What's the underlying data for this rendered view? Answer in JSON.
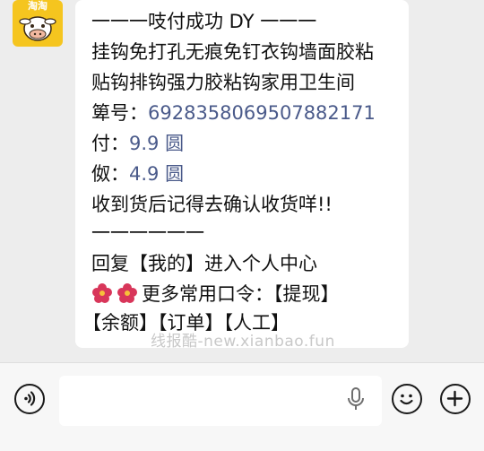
{
  "avatar": {
    "brand_text": "淘淘"
  },
  "message": {
    "line1": "一一一吱付成功 DY 一一一",
    "line2": "挂钩免打孔无痕免钉衣钩墙面胶粘",
    "line3": "贴钩排钩强力胶粘钩家用卫生间",
    "order_label": "箄号：",
    "order_number": "6928358069507882171",
    "paid_label": "付：",
    "paid_value": "9.9 圆",
    "refund_label": "伮：",
    "refund_value": "4.9 圆",
    "reminder": "收到货后记得去确认收货咩!!",
    "divider": "一一一一一一",
    "reply_hint": "回复【我的】进入个人中心",
    "more_commands": "更多常用口令：【提现】",
    "commands_line": "【余额】【订单】【人工】"
  },
  "watermark": "线报酷-new.xianbao.fun",
  "input_bar": {
    "voice_icon": "voice-icon",
    "mic_icon": "microphone-icon",
    "emoji_icon": "emoji-icon",
    "plus_icon": "plus-icon"
  },
  "colors": {
    "number": "#4a5a8a",
    "avatar_bg": "#f5c51f",
    "flower": "#d8365a"
  }
}
